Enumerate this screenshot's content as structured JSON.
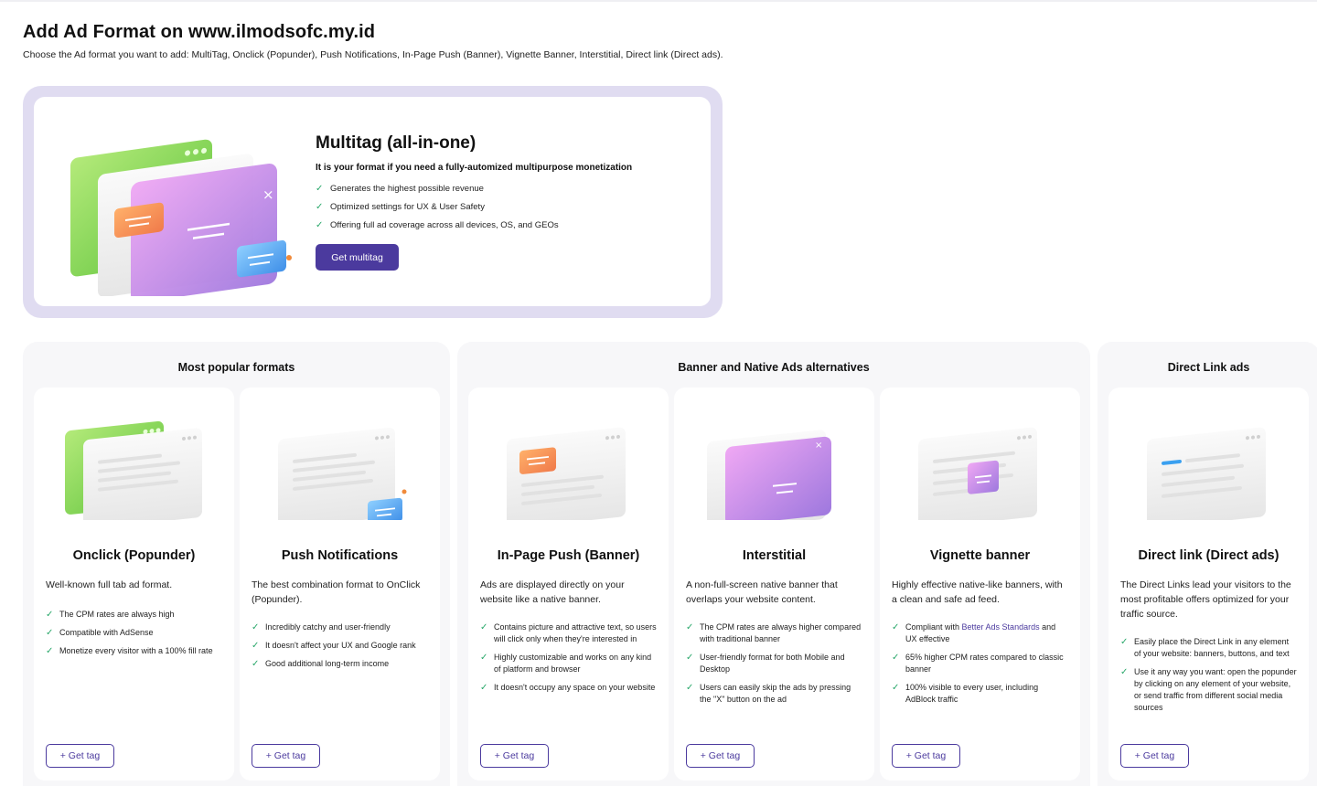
{
  "header": {
    "title": "Add Ad Format on www.ilmodsofc.my.id",
    "subtitle": "Choose the Ad format you want to add: MultiTag, Onclick (Popunder), Push Notifications, In-Page Push (Banner), Vignette Banner, Interstitial, Direct link (Direct ads)."
  },
  "multitag": {
    "title": "Multitag (all-in-one)",
    "subtitle": "It is your format if you need a fully-automized multipurpose monetization",
    "features": [
      "Generates the highest possible revenue",
      "Optimized settings for UX & User Safety",
      "Offering full ad coverage across all devices, OS, and GEOs"
    ],
    "button_label": "Get multitag"
  },
  "groups": {
    "popular": {
      "title": "Most popular formats"
    },
    "banner": {
      "title": "Banner and Native Ads alternatives"
    },
    "direct": {
      "title": "Direct Link ads"
    }
  },
  "check_glyph": "✓",
  "get_tag_label": "+ Get tag",
  "formats": {
    "onclick": {
      "title": "Onclick (Popunder)",
      "desc": "Well-known full tab ad format.",
      "features": [
        "The CPM rates are always high",
        "Compatible with AdSense",
        "Monetize every visitor with a 100% fill rate"
      ]
    },
    "push": {
      "title": "Push Notifications",
      "desc": "The best combination format to OnClick (Popunder).",
      "features": [
        "Incredibly catchy and user-friendly",
        "It doesn't affect your UX and Google rank",
        "Good additional long-term income"
      ]
    },
    "inpage": {
      "title": "In-Page Push (Banner)",
      "desc": "Ads are displayed directly on your website like a native banner.",
      "features": [
        "Contains picture and attractive text, so users will click only when they're interested in",
        "Highly customizable and works on any kind of platform and browser",
        "It doesn't occupy any space on your website"
      ]
    },
    "interstitial": {
      "title": "Interstitial",
      "desc": "A non-full-screen native banner that overlaps your website content.",
      "features": [
        "The CPM rates are always higher compared with traditional banner",
        "User-friendly format for both Mobile and Desktop",
        "Users can easily skip the ads by pressing the \"X\" button on the ad"
      ]
    },
    "vignette": {
      "title": "Vignette banner",
      "desc": "Highly effective native-like banners, with a clean and safe ad feed.",
      "feature1_prefix": "Compliant with ",
      "feature1_link": "Better Ads Standards",
      "feature1_suffix": " and UX effective",
      "features": [
        "65% higher CPM rates compared to classic banner",
        "100% visible to every user, including AdBlock traffic"
      ]
    },
    "direct": {
      "title": "Direct link (Direct ads)",
      "desc": "The Direct Links lead your visitors to the most profitable offers optimized for your traffic source.",
      "features": [
        "Easily place the Direct Link in any element of your website: banners, buttons, and text",
        "Use it any way you want: open the popunder by clicking on any element of your website, or send traffic from different social media sources"
      ]
    }
  },
  "colors": {
    "accent": "#4b3a9e",
    "check": "#2aa86b",
    "hero_frame": "#e0dcf1",
    "group_bg": "#f7f7f9"
  }
}
